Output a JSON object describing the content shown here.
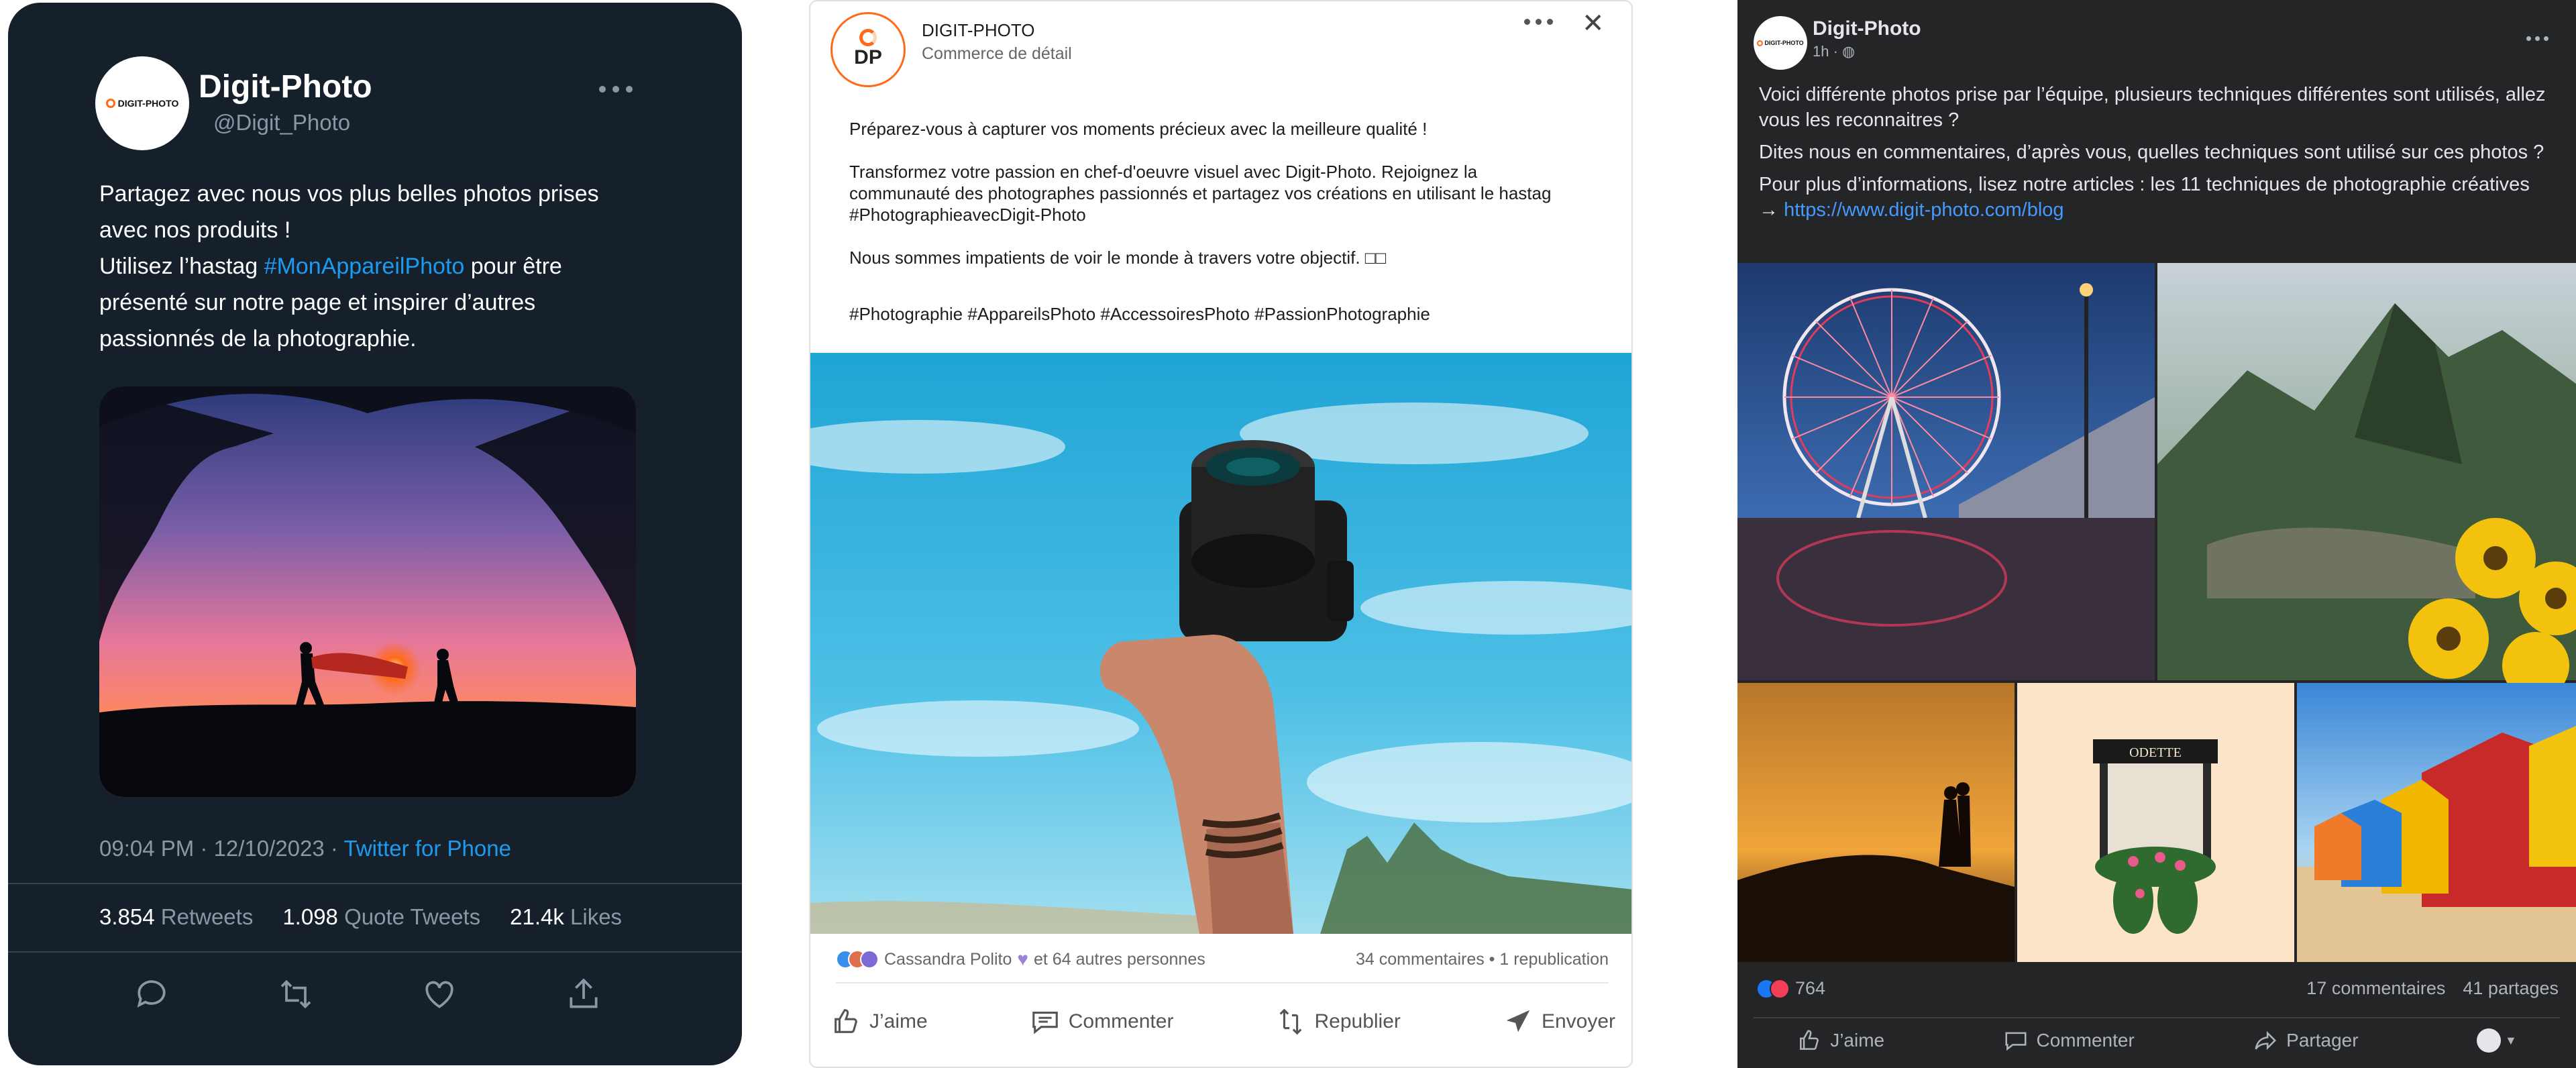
{
  "twitter": {
    "logo_text": "DIGIT-PHOTO",
    "name": "Digit-Photo",
    "handle": "@Digit_Photo",
    "body_line1": "Partagez avec nous vos plus belles photos prises avec nos produits !",
    "body_pre": "Utilisez l’hastag ",
    "body_hashtag": "#MonAppareilPhoto",
    "body_post": " pour être présenté sur notre page et inspirer d’autres passionnés de la photographie.",
    "timestamp": "09:04 PM · 12/10/2023 · ",
    "via": "Twitter for Phone",
    "retweets_count": "3.854",
    "retweets_label": "Retweets",
    "quotes_count": "1.098",
    "quotes_label": "Quote Tweets",
    "likes_count": "21.4k",
    "likes_label": "Likes",
    "actions": [
      "reply-icon",
      "retweet-icon",
      "like-icon",
      "share-icon"
    ]
  },
  "linkedin": {
    "logo_text": "DP",
    "name": "DIGIT-PHOTO",
    "subtitle": "Commerce de détail",
    "p1": "Préparez-vous à capturer vos moments précieux avec la meilleure qualité !",
    "p2": "Transformez votre passion en chef-d'oeuvre visuel avec Digit-Photo. Rejoignez la communauté des photographes passionnés et partagez vos créations en utilisant le hastag #PhotographieavecDigit-Photo",
    "p3": "Nous sommes impatients de voir le monde à travers votre objectif. □□",
    "p4": " #Photographie #AppareilsPhoto #AccessoiresPhoto #PassionPhotographie",
    "reactors": "Cassandra Polito",
    "reactors_rest": "et 64 autres personnes",
    "comments": "34 commentaires • 1 republication",
    "actions": [
      {
        "label": "J’aime",
        "icon": "like-icon"
      },
      {
        "label": "Commenter",
        "icon": "comment-icon"
      },
      {
        "label": "Republier",
        "icon": "repost-icon"
      },
      {
        "label": "Envoyer",
        "icon": "send-icon"
      }
    ]
  },
  "facebook": {
    "logo_text": "DIGIT-PHOTO",
    "name": "Digit-Photo",
    "meta": "1h · ",
    "p1": "Voici différente photos prise par l’équipe, plusieurs techniques différentes sont utilisés, allez vous les reconnaitres ?",
    "p2": "Dites nous en commentaires, d’après vous, quelles techniques sont utilisé sur ces photos ?",
    "p3": "Pour plus d’informations, lisez notre articles : les 11 techniques de photographie créatives",
    "p3_arrow": "→ ",
    "link": "https://www.digit-photo.com/blog",
    "sign_text": "ODETTE",
    "reactions_count": "764",
    "comments": "17 commentaires",
    "shares": "41 partages",
    "actions": [
      {
        "label": "J’aime",
        "icon": "like-icon"
      },
      {
        "label": "Commenter",
        "icon": "comment-icon"
      },
      {
        "label": "Partager",
        "icon": "share-icon"
      }
    ]
  }
}
